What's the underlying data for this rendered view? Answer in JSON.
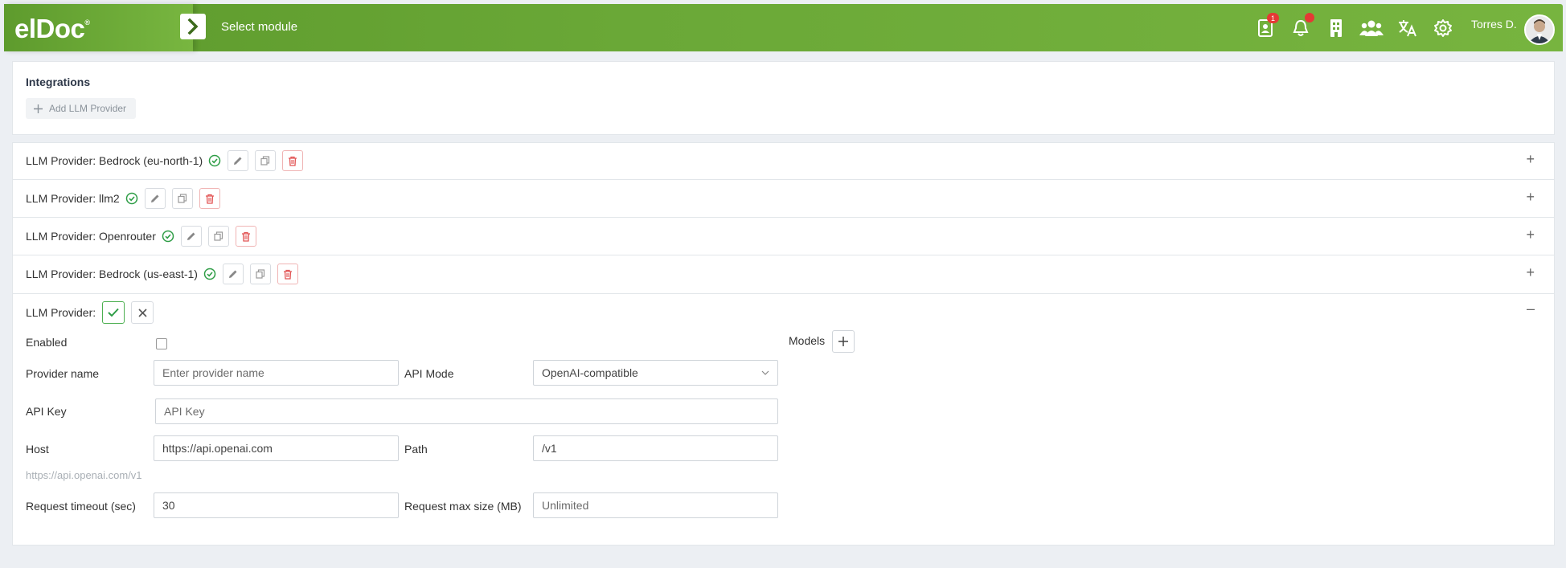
{
  "header": {
    "logo": "elDoc",
    "module_label": "Select module",
    "notifications_count": "1",
    "username": "Torres D.",
    "icons": [
      "contacts-icon",
      "bell-icon",
      "building-icon",
      "users-icon",
      "translate-icon",
      "gear-icon"
    ]
  },
  "integrations": {
    "title": "Integrations",
    "add_button": "Add LLM Provider"
  },
  "providers": [
    {
      "label": "LLM Provider: Bedrock (eu-north-1)"
    },
    {
      "label": "LLM Provider: llm2"
    },
    {
      "label": "LLM Provider: Openrouter"
    },
    {
      "label": "LLM Provider: Bedrock (us-east-1)"
    }
  ],
  "new_provider": {
    "label": "LLM Provider:",
    "enabled_label": "Enabled",
    "provider_name_label": "Provider name",
    "provider_name_placeholder": "Enter provider name",
    "api_mode_label": "API Mode",
    "api_mode_value": "OpenAI-compatible",
    "api_key_label": "API Key",
    "api_key_placeholder": "API Key",
    "host_label": "Host",
    "host_value": "https://api.openai.com",
    "path_label": "Path",
    "path_value": "/v1",
    "url_hint": "https://api.openai.com/v1",
    "timeout_label": "Request timeout (sec)",
    "timeout_value": "30",
    "max_size_label": "Request max size (MB)",
    "max_size_placeholder": "Unlimited",
    "models_label": "Models"
  },
  "colors": {
    "header_green": "#6aa837",
    "ok_green": "#2e9d46",
    "delete_red": "#e25555"
  }
}
